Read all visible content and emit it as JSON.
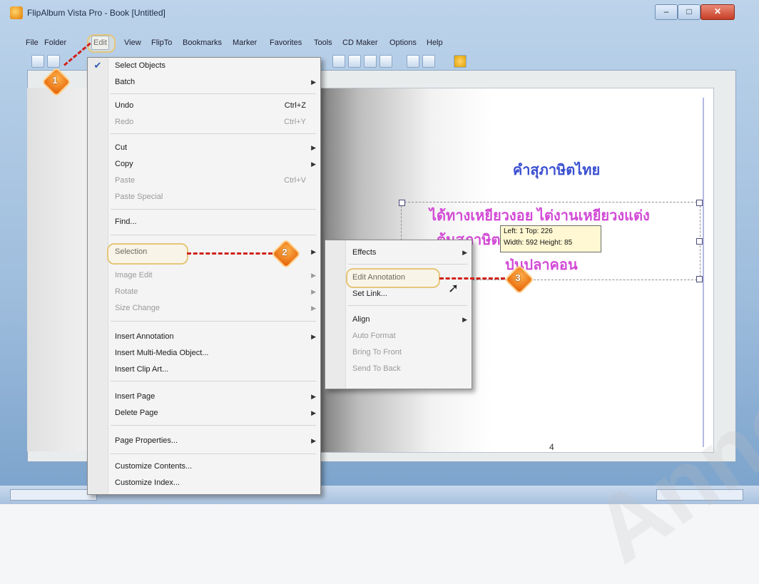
{
  "window": {
    "title": "FlipAlbum Vista Pro - Book [Untitled]",
    "controls": {
      "minimize": "–",
      "maximize": "□",
      "close": "✕"
    }
  },
  "menubar": {
    "items": [
      "File",
      "Folder",
      "Edit",
      "View",
      "FlipTo",
      "Bookmarks",
      "Marker",
      "Favorites",
      "Tools",
      "CD Maker",
      "Options",
      "Help"
    ]
  },
  "edit_menu": {
    "items": [
      {
        "label": "Select Objects",
        "checked": true,
        "shortcut": "",
        "submenu": false,
        "disabled": false
      },
      {
        "label": "Batch",
        "shortcut": "",
        "submenu": true,
        "disabled": false
      },
      {
        "label": "Undo",
        "shortcut": "Ctrl+Z",
        "submenu": false,
        "disabled": false
      },
      {
        "label": "Redo",
        "shortcut": "Ctrl+Y",
        "submenu": false,
        "disabled": true
      },
      {
        "label": "Cut",
        "shortcut": "",
        "submenu": true,
        "disabled": false
      },
      {
        "label": "Copy",
        "shortcut": "",
        "submenu": true,
        "disabled": false
      },
      {
        "label": "Paste",
        "shortcut": "Ctrl+V",
        "submenu": false,
        "disabled": true
      },
      {
        "label": "Paste Special",
        "shortcut": "",
        "submenu": false,
        "disabled": true
      },
      {
        "label": "Find...",
        "shortcut": "",
        "submenu": false,
        "disabled": false
      },
      {
        "label": "Selection",
        "shortcut": "",
        "submenu": true,
        "disabled": false
      },
      {
        "label": "Image Edit",
        "shortcut": "",
        "submenu": true,
        "disabled": true
      },
      {
        "label": "Rotate",
        "shortcut": "",
        "submenu": true,
        "disabled": true
      },
      {
        "label": "Size Change",
        "shortcut": "",
        "submenu": true,
        "disabled": true
      },
      {
        "label": "Insert Annotation",
        "shortcut": "",
        "submenu": true,
        "disabled": false
      },
      {
        "label": "Insert Multi-Media Object...",
        "shortcut": "",
        "submenu": false,
        "disabled": false
      },
      {
        "label": "Insert Clip Art...",
        "shortcut": "",
        "submenu": false,
        "disabled": false
      },
      {
        "label": "Insert Page",
        "shortcut": "",
        "submenu": true,
        "disabled": false
      },
      {
        "label": "Delete Page",
        "shortcut": "",
        "submenu": true,
        "disabled": false
      },
      {
        "label": "Page Properties...",
        "shortcut": "",
        "submenu": true,
        "disabled": false
      },
      {
        "label": "Customize Contents...",
        "shortcut": "",
        "submenu": false,
        "disabled": false
      },
      {
        "label": "Customize Index...",
        "shortcut": "",
        "submenu": false,
        "disabled": false
      }
    ]
  },
  "selection_submenu": {
    "items": [
      {
        "label": "Effects",
        "submenu": true,
        "disabled": false
      },
      {
        "label": "Edit Annotation",
        "submenu": false,
        "disabled": false
      },
      {
        "label": "Set Link...",
        "submenu": false,
        "disabled": false
      },
      {
        "label": "Align",
        "submenu": true,
        "disabled": false
      },
      {
        "label": "Auto Format",
        "submenu": false,
        "disabled": true
      },
      {
        "label": "Bring To Front",
        "submenu": false,
        "disabled": true
      },
      {
        "label": "Send To Back",
        "submenu": false,
        "disabled": true
      }
    ]
  },
  "page": {
    "title": "คำสุภาษิตไทย",
    "lines": [
      "ได้ทางเหยียวงอย ไต่งานเหยียวงแต่ง",
      "ต้นสุภาษิต         บานเปิด",
      "ป่นปลาคอน"
    ],
    "tooltip": {
      "line1": "Left: 1  Top: 226",
      "line2": "Width: 592 Height: 85"
    },
    "page_number": "4"
  },
  "steps": [
    "1",
    "2",
    "3"
  ],
  "watermark": "Annokang",
  "colors": {
    "title_blue": "#3a4fd0",
    "body_magenta": "#d24ad6",
    "step_badge": "#e25b00",
    "arrow_red": "#d0211c"
  }
}
